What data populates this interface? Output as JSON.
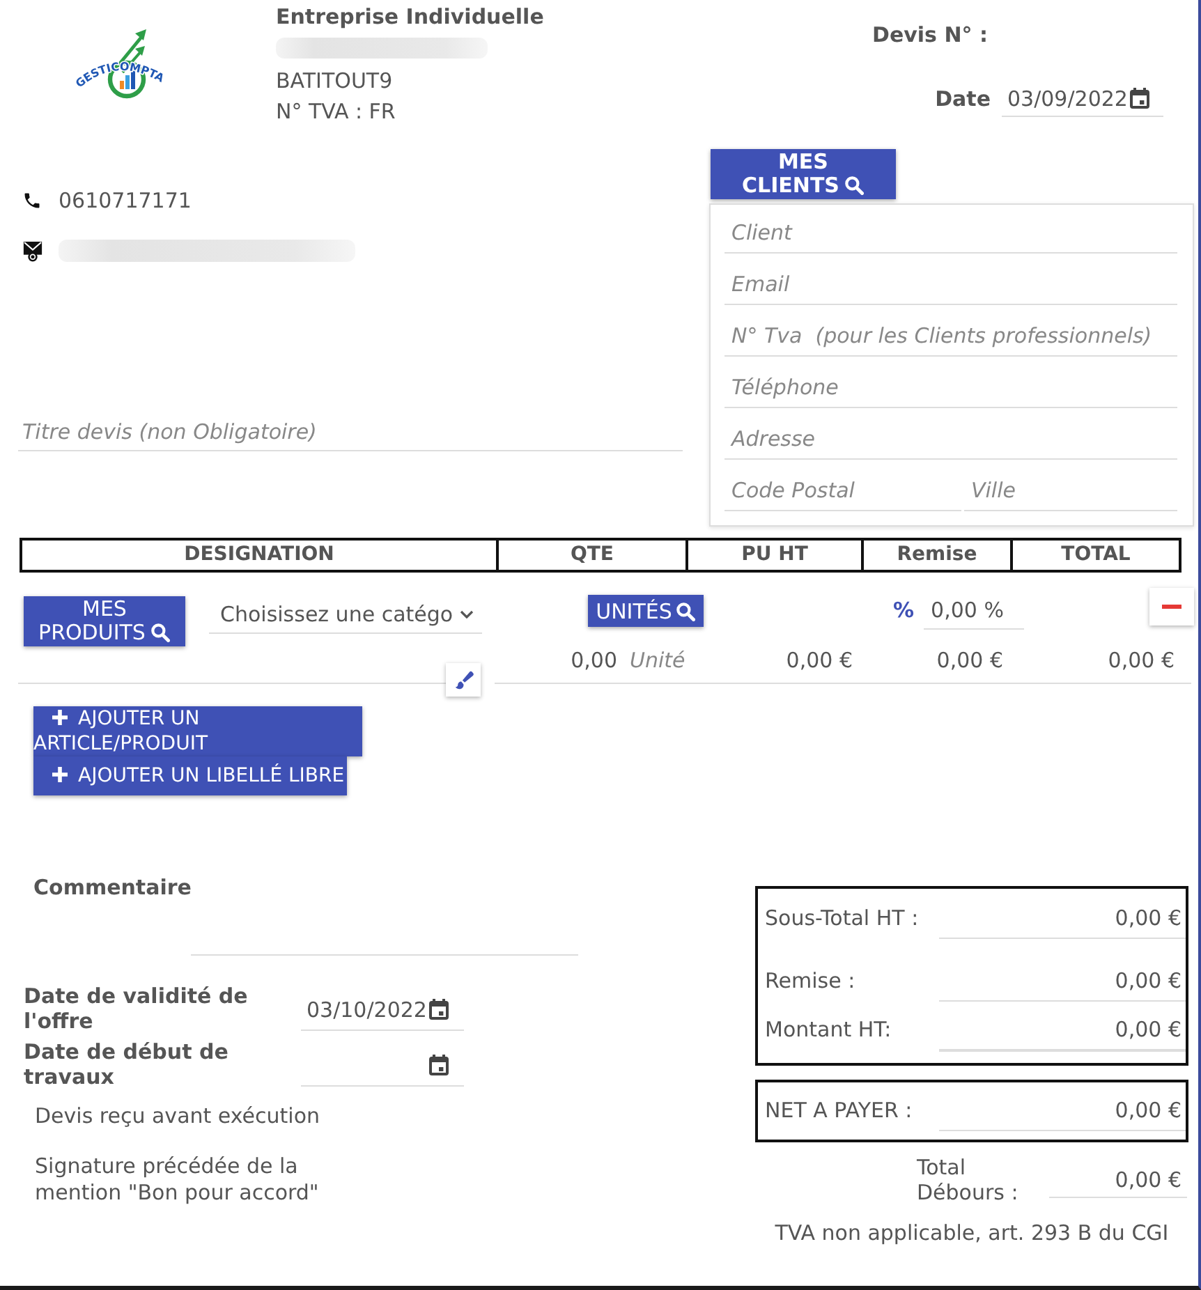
{
  "header": {
    "logo_text": "GESTICOMPTA",
    "company": {
      "title": "Entreprise Individuelle",
      "name_redacted": true,
      "code": "BATITOUT9",
      "vat": "N° TVA : FR"
    },
    "quote_number_label": "Devis N° :",
    "date_label": "Date",
    "date": "03/09/2022"
  },
  "contact": {
    "phone": "0610717171",
    "email_redacted": true
  },
  "title_field": {
    "placeholder": "Titre devis (non Obligatoire)"
  },
  "clients": {
    "button": "MES CLIENTS",
    "fields": [
      {
        "placeholder": "Client"
      },
      {
        "placeholder": "Email"
      },
      {
        "placeholder": "N° Tva  (pour les Clients professionnels)"
      },
      {
        "placeholder": "Téléphone"
      },
      {
        "placeholder": "Adresse"
      }
    ],
    "last_row": [
      {
        "placeholder": "Code Postal"
      },
      {
        "placeholder": "Ville"
      }
    ]
  },
  "table": {
    "columns": [
      "DESIGNATION",
      "QTE",
      "PU HT",
      "Remise",
      "TOTAL"
    ],
    "rows": [
      {
        "products_button": "MES PRODUITS",
        "category": "Choisissez une catégo",
        "units_button": "UNITÉS",
        "discount_symbol": "%",
        "discount": "0,00 %",
        "quantity": "0,00",
        "unit": "Unité",
        "unit_price": "0,00 €",
        "discount_amount": "0,00 €",
        "total": "0,00 €"
      }
    ]
  },
  "add_buttons": [
    "AJOUTER UN ARTICLE/PRODUIT",
    "AJOUTER UN LIBELLÉ LIBRE"
  ],
  "comment": {
    "label": "Commentaire"
  },
  "dates": [
    {
      "label": "Date de validité de l'offre",
      "value": "03/10/2022"
    },
    {
      "label": "Date de début de travaux"
    }
  ],
  "notes": [
    "Devis reçu avant exécution",
    "Signature précédée de la mention \"Bon pour accord\""
  ],
  "totals": {
    "groups": [
      [
        {
          "label": "Sous-Total HT :",
          "value": "0,00 €"
        },
        {
          "label": "Remise :",
          "value": "0,00 €"
        },
        {
          "label": "Montant HT:",
          "value": "0,00 €"
        }
      ],
      [
        {
          "label": "NET A PAYER :",
          "value": "0,00 €"
        }
      ]
    ],
    "disbursements": {
      "label": "Total Débours :",
      "value": "0,00 €"
    },
    "vat_note": "TVA non applicable, art. 293 B du CGI"
  }
}
